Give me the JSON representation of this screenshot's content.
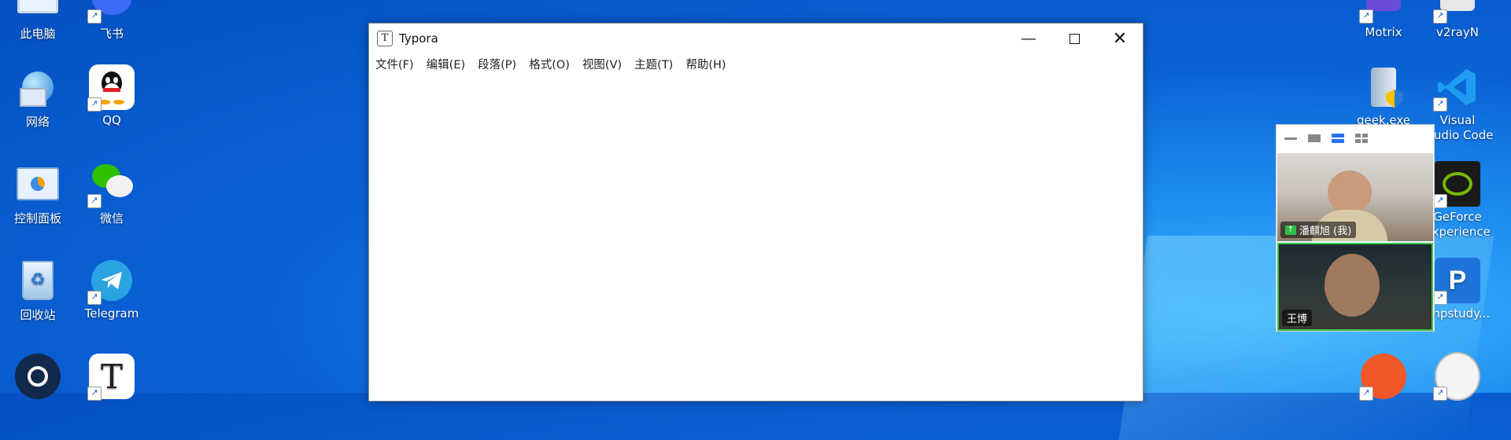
{
  "desktop_left": [
    {
      "label": "此电脑",
      "icon": "computer-icon"
    },
    {
      "label": "飞书",
      "icon": "feishu-icon"
    },
    {
      "label": "网络",
      "icon": "network-icon"
    },
    {
      "label": "QQ",
      "icon": "qq-icon"
    },
    {
      "label": "控制面板",
      "icon": "control-panel-icon"
    },
    {
      "label": "微信",
      "icon": "wechat-icon"
    },
    {
      "label": "回收站",
      "icon": "recycle-bin-icon"
    },
    {
      "label": "Telegram",
      "icon": "telegram-icon"
    },
    {
      "label": "",
      "icon": "steam-icon"
    },
    {
      "label": "",
      "icon": "typora-icon"
    }
  ],
  "desktop_right": [
    {
      "label": "Motrix",
      "icon": "motrix-icon"
    },
    {
      "label": "v2rayN",
      "icon": "v2rayn-icon"
    },
    {
      "label": "geek.exe",
      "icon": "geek-icon"
    },
    {
      "label": "Visual Studio Code",
      "icon": "vscode-icon"
    },
    {
      "label": "GeForce Experience",
      "icon": "geforce-icon"
    },
    {
      "label": "phpstudy...",
      "icon": "phpstudy-icon"
    }
  ],
  "window": {
    "title": "Typora",
    "app_icon_letter": "T",
    "menu": [
      "文件(F)",
      "编辑(E)",
      "段落(P)",
      "格式(O)",
      "视图(V)",
      "主题(T)",
      "帮助(H)"
    ]
  },
  "call": {
    "participants": [
      {
        "name": "潘麒旭 (我)",
        "sharing": true
      },
      {
        "name": "王博",
        "sharing": false
      }
    ]
  }
}
